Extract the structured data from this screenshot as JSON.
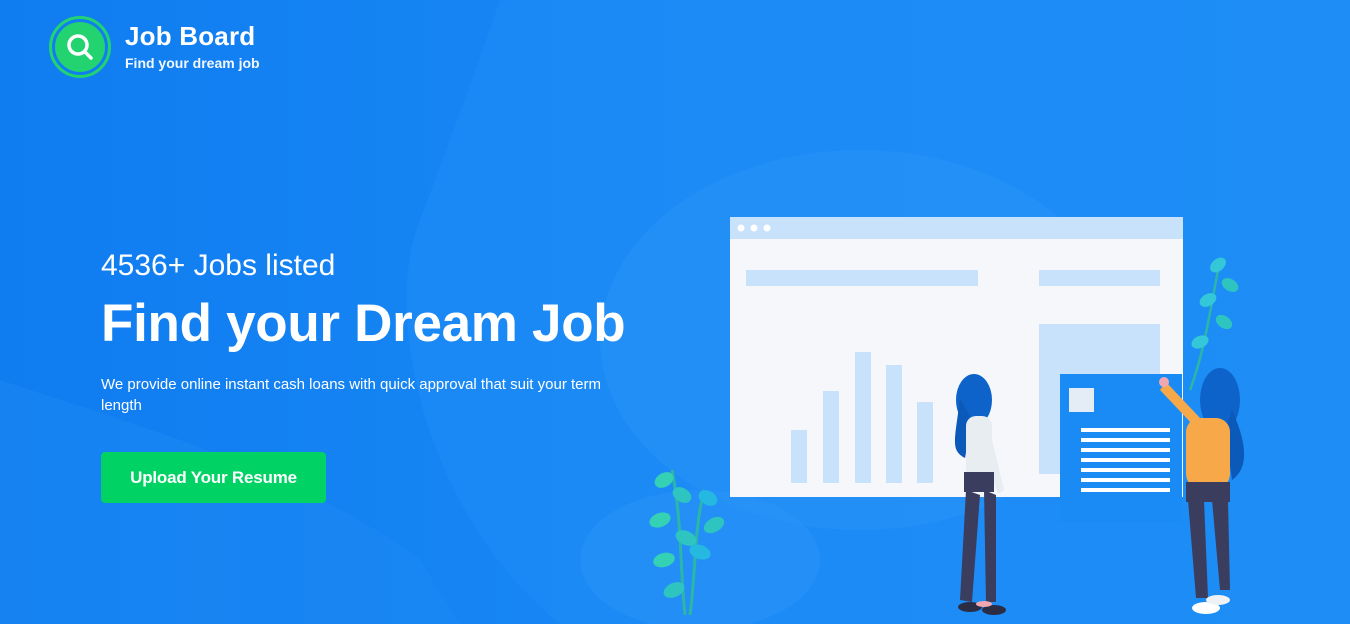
{
  "brand": {
    "name": "Job Board",
    "tagline": "Find your dream job",
    "icon": "magnifier-icon",
    "accent_color": "#22d370"
  },
  "hero": {
    "jobs_listed": "4536+ Jobs listed",
    "headline": "Find your Dream Job",
    "description": "We provide online instant cash loans with quick approval that suit your term length",
    "cta_label": "Upload Your Resume",
    "cta_color": "#00d363",
    "background_color": "#1585f3"
  },
  "illustration": {
    "subject": "two-people-reviewing-job-dashboard"
  }
}
